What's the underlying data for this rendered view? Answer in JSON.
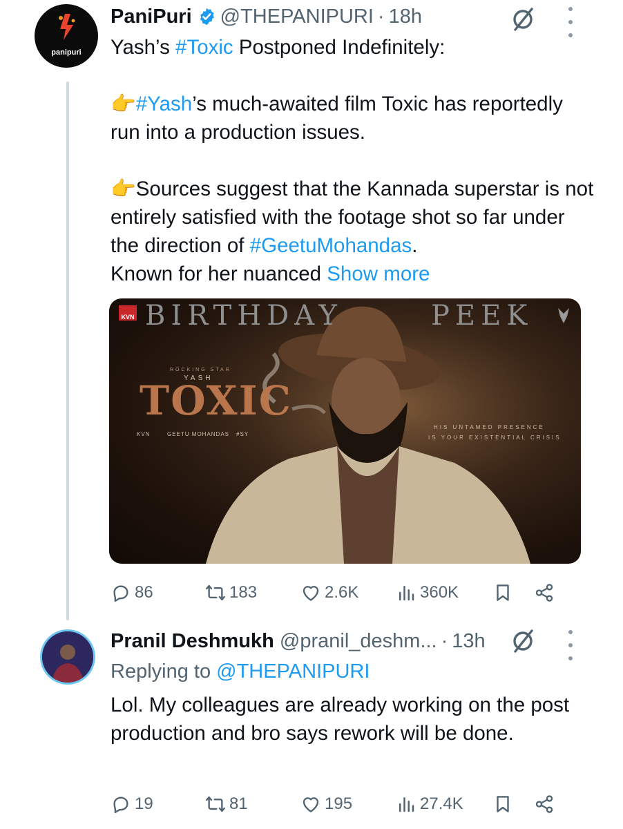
{
  "tweet": {
    "author_name": "PaniPuri",
    "handle": "@THEPANIPURI",
    "separator": "·",
    "time": "18h",
    "avatar_text": "panipuri",
    "line1_pre": "Yash’s ",
    "line1_tag": "#Toxic",
    "line1_post": " Postponed Indefinitely:",
    "p2_emoji": "👉",
    "p2_tag": "#Yash",
    "p2_text": "’s much-awaited film Toxic has reportedly run into a production issues.",
    "p3_emoji": "👉",
    "p3_text": "Sources suggest that the Kannada superstar is not entirely satisfied with the footage shot so far under the direction of ",
    "p3_tag": "#GeetuMohandas",
    "p3_end": ".",
    "p4_text": "Known for her nuanced ",
    "show_more": "Show more",
    "media": {
      "banner_left": "BIRTHDAY",
      "banner_right": "PEEK",
      "kvn_badge": "KVN",
      "rocking_star": "ROCKING STAR",
      "yash": "YASH",
      "title": "TOXIC",
      "credit_kvn": "KVN",
      "credit_director": "GEETU MOHANDAS",
      "credit_sy": "#SY",
      "tagline1": "HIS UNTAMED PRESENCE",
      "tagline2": "IS YOUR EXISTENTIAL CRISIS"
    },
    "stats": {
      "replies": "86",
      "retweets": "183",
      "likes": "2.6K",
      "views": "360K"
    }
  },
  "reply": {
    "author_name": "Pranil Deshmukh",
    "handle": "@pranil_deshm...",
    "separator": "·",
    "time": "13h",
    "replying_label": "Replying to ",
    "replying_handle": "@THEPANIPURI",
    "text": "Lol. My colleagues are already working on the post production and bro says rework will be done.",
    "stats": {
      "replies": "19",
      "retweets": "81",
      "likes": "195",
      "views": "27.4K"
    }
  },
  "colors": {
    "link": "#1d9bf0",
    "muted": "#536471",
    "text": "#0f1419",
    "verified": "#1d9bf0"
  }
}
